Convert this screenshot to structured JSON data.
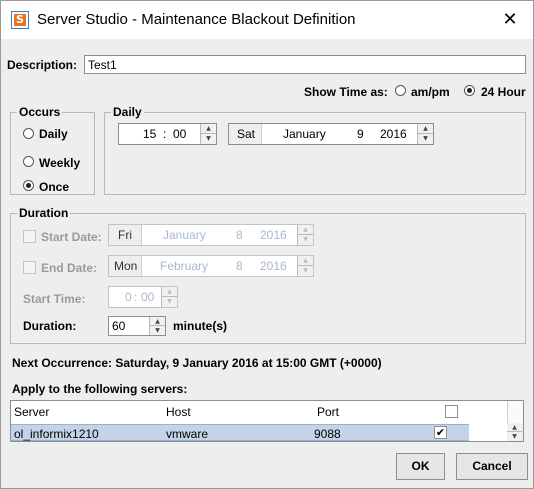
{
  "window": {
    "title": "Server Studio - Maintenance Blackout Definition",
    "close_glyph": "✕"
  },
  "description": {
    "label": "Description:",
    "value": "Test1"
  },
  "show_time": {
    "label": "Show Time as:",
    "options": [
      "am/pm",
      "24 Hour"
    ],
    "selected": "24 Hour"
  },
  "occurs": {
    "title": "Occurs",
    "options": [
      "Daily",
      "Weekly",
      "Once"
    ],
    "selected": "Once"
  },
  "daily": {
    "title": "Daily",
    "time": {
      "hour": "15",
      "sep": ":",
      "minute": "00"
    },
    "date": {
      "day_name": "Sat",
      "month": "January",
      "day": "9",
      "year": "2016"
    }
  },
  "duration": {
    "title": "Duration",
    "start_date": {
      "label": "Start Date:",
      "checked": false,
      "day_name": "Fri",
      "month": "January",
      "day": "8",
      "year": "2016"
    },
    "end_date": {
      "label": "End Date:",
      "checked": false,
      "day_name": "Mon",
      "month": "February",
      "day": "8",
      "year": "2016"
    },
    "start_time": {
      "label": "Start Time:",
      "hour": "0",
      "sep": ":",
      "minute": "00"
    },
    "length": {
      "label": "Duration:",
      "value": "60",
      "unit": "minute(s)"
    }
  },
  "next_occurrence": "Next Occurrence: Saturday, 9 January 2016 at 15:00 GMT (+0000)",
  "servers": {
    "label": "Apply to the following servers:",
    "columns": [
      "Server",
      "Host",
      "Port"
    ],
    "rows": [
      {
        "server": "ol_informix1210",
        "host": "vmware",
        "port": "9088",
        "checked": "✔"
      }
    ]
  },
  "buttons": {
    "ok": "OK",
    "cancel": "Cancel"
  },
  "icons": {
    "spin_up": "▲",
    "spin_down": "▼",
    "app_letter": "S"
  }
}
